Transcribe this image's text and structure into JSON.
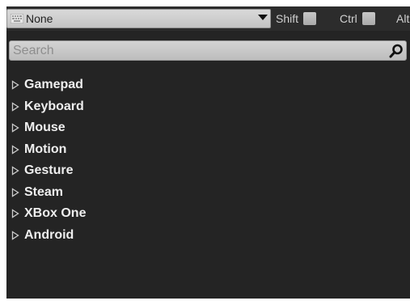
{
  "key_selector": {
    "value": "None",
    "icon": "keyboard-icon"
  },
  "modifiers": [
    {
      "label": "Shift",
      "checked": false
    },
    {
      "label": "Ctrl",
      "checked": false
    },
    {
      "label": "Alt",
      "checked": false
    }
  ],
  "search": {
    "value": "",
    "placeholder": "Search",
    "icon": "search-icon"
  },
  "categories": [
    {
      "label": "Gamepad",
      "expanded": false
    },
    {
      "label": "Keyboard",
      "expanded": false
    },
    {
      "label": "Mouse",
      "expanded": false
    },
    {
      "label": "Motion",
      "expanded": false
    },
    {
      "label": "Gesture",
      "expanded": false
    },
    {
      "label": "Steam",
      "expanded": false
    },
    {
      "label": "XBox One",
      "expanded": false
    },
    {
      "label": "Android",
      "expanded": false
    }
  ],
  "colors": {
    "panel_background": "#242424",
    "text": "#eeeeee"
  }
}
